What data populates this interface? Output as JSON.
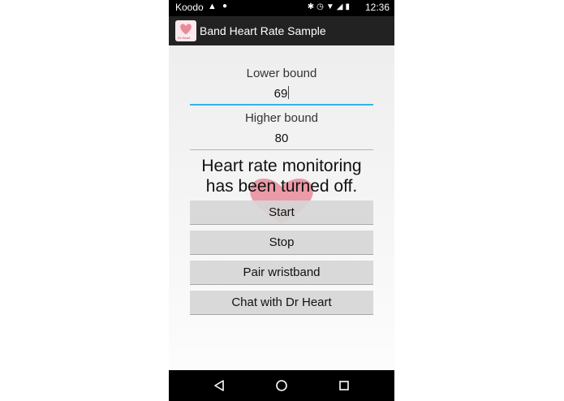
{
  "status_bar": {
    "carrier": "Koodo",
    "time": "12:36"
  },
  "action_bar": {
    "title": "Band Heart Rate Sample"
  },
  "form": {
    "lower_label": "Lower bound",
    "lower_value": "69",
    "higher_label": "Higher bound",
    "higher_value": "80"
  },
  "message": {
    "line1": "Heart rate monitoring",
    "line2": "has been turned off."
  },
  "buttons": {
    "start": "Start",
    "stop": "Stop",
    "pair": "Pair wristband",
    "chat": "Chat with Dr Heart"
  },
  "colors": {
    "focus_underline": "#33b5e5",
    "heart": "#e98a9a",
    "action_bar": "#222222"
  },
  "icons": {
    "nav_back": "back-triangle-icon",
    "nav_home": "home-circle-icon",
    "nav_recents": "recents-square-icon"
  }
}
